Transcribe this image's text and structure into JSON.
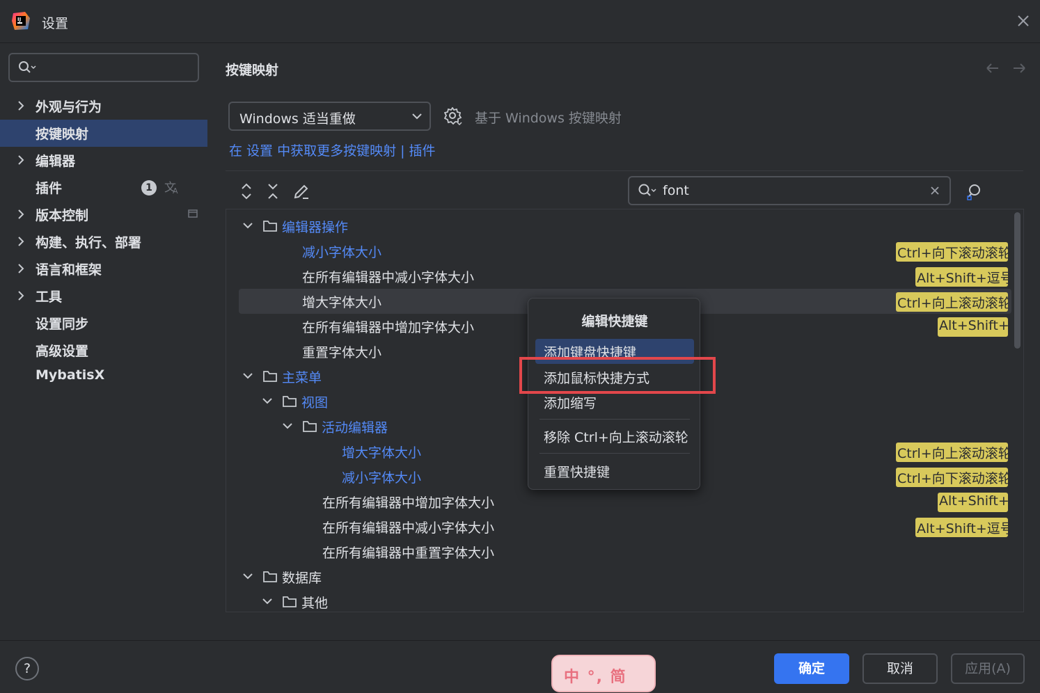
{
  "window": {
    "title": "设置"
  },
  "sidebar": {
    "items": [
      {
        "label": "外观与行为",
        "expandable": true
      },
      {
        "label": "按键映射",
        "expandable": false,
        "selected": true
      },
      {
        "label": "编辑器",
        "expandable": true
      },
      {
        "label": "插件",
        "expandable": false,
        "badge": "1"
      },
      {
        "label": "版本控制",
        "expandable": true
      },
      {
        "label": "构建、执行、部署",
        "expandable": true
      },
      {
        "label": "语言和框架",
        "expandable": true
      },
      {
        "label": "工具",
        "expandable": true
      },
      {
        "label": "设置同步",
        "expandable": false
      },
      {
        "label": "高级设置",
        "expandable": false
      },
      {
        "label": "MybatisX",
        "expandable": false
      }
    ]
  },
  "main": {
    "title": "按键映射",
    "keymap_select": "Windows 适当重做",
    "based_on": "基于 Windows 按键映射",
    "link_text": "在 设置 中获取更多按键映射 | 插件",
    "filter_value": "font"
  },
  "tree": {
    "rows": [
      {
        "label": "编辑器操作",
        "kind": "folder",
        "color": "blue"
      },
      {
        "label": "减小字体大小",
        "kind": "action",
        "color": "blue",
        "shortcut": "Ctrl+向下滚动滚轮"
      },
      {
        "label": "在所有编辑器中减小字体大小",
        "kind": "action",
        "color": "white",
        "shortcut": "Alt+Shift+逗号"
      },
      {
        "label": "增大字体大小",
        "kind": "action",
        "color": "white",
        "shortcut": "Ctrl+向上滚动滚轮"
      },
      {
        "label": "在所有编辑器中增加字体大小",
        "kind": "action",
        "color": "white",
        "shortcut": "Alt+Shift+"
      },
      {
        "label": "重置字体大小",
        "kind": "action",
        "color": "white"
      },
      {
        "label": "主菜单",
        "kind": "folder",
        "color": "blue"
      },
      {
        "label": "视图",
        "kind": "folder",
        "color": "blue"
      },
      {
        "label": "活动编辑器",
        "kind": "folder",
        "color": "blue"
      },
      {
        "label": "增大字体大小",
        "kind": "action",
        "color": "blue",
        "shortcut": "Ctrl+向上滚动滚轮"
      },
      {
        "label": "减小字体大小",
        "kind": "action",
        "color": "blue",
        "shortcut": "Ctrl+向下滚动滚轮"
      },
      {
        "label": "在所有编辑器中增加字体大小",
        "kind": "action",
        "color": "white",
        "shortcut": "Alt+Shift+"
      },
      {
        "label": "在所有编辑器中减小字体大小",
        "kind": "action",
        "color": "white",
        "shortcut": "Alt+Shift+逗号"
      },
      {
        "label": "在所有编辑器中重置字体大小",
        "kind": "action",
        "color": "white"
      },
      {
        "label": "数据库",
        "kind": "folder",
        "color": "white"
      },
      {
        "label": "其他",
        "kind": "folder",
        "color": "white"
      }
    ]
  },
  "popup": {
    "title": "编辑快捷键",
    "items": [
      "添加键盘快捷键",
      "添加鼠标快捷方式",
      "添加缩写",
      "移除 Ctrl+向上滚动滚轮",
      "重置快捷键"
    ]
  },
  "footer": {
    "help": "?",
    "ok": "确定",
    "cancel": "取消",
    "apply": "应用(A)",
    "ime_text": "中 °, 简"
  },
  "colors": {
    "accent": "#3574f0",
    "selection": "#2e436e",
    "link": "#548af7",
    "shortcut_bg": "#d8c95b",
    "highlight_box": "#e2474b"
  }
}
